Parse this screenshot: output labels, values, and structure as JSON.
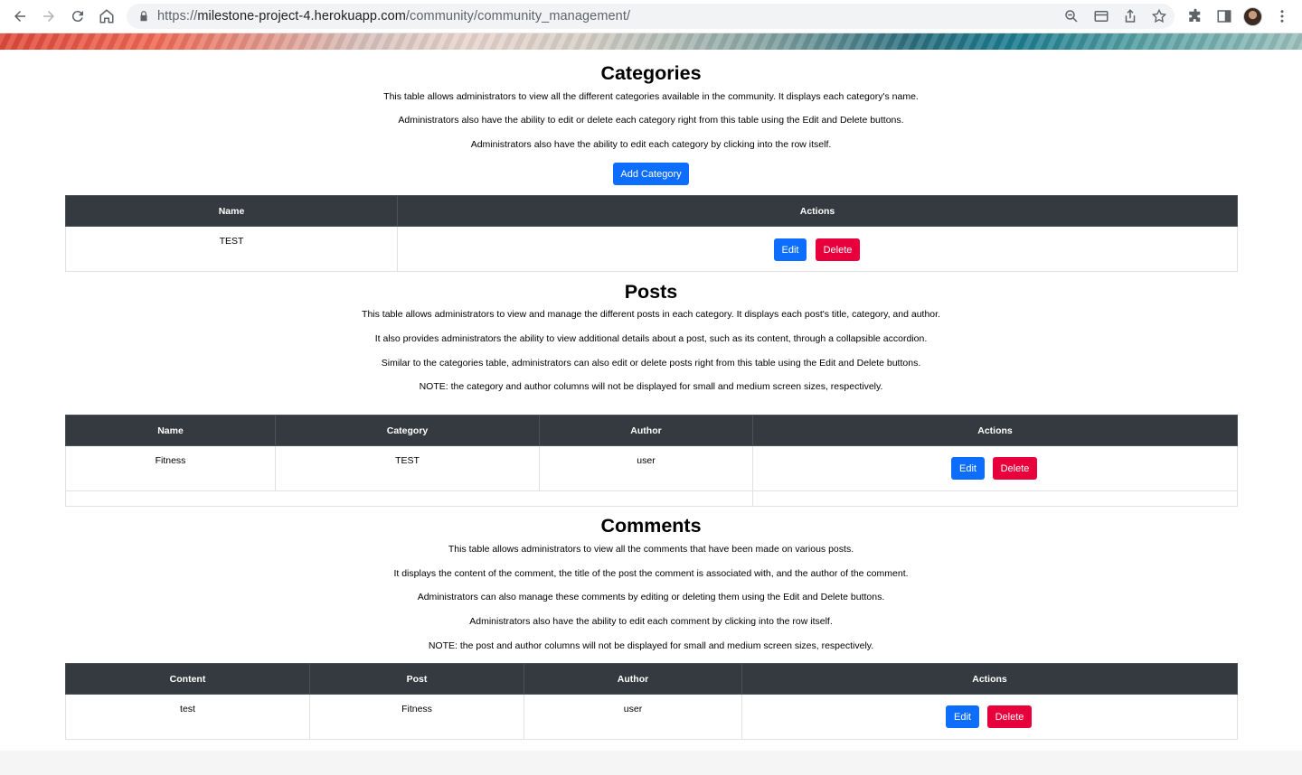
{
  "browser": {
    "url_scheme": "https://",
    "url_host": "milestone-project-4.herokuapp.com",
    "url_path": "/community/community_management/"
  },
  "categories": {
    "title": "Categories",
    "paragraphs": [
      "This table allows administrators to view all the different categories available in the community. It displays each category's name.",
      "Administrators also have the ability to edit or delete each category right from this table using the Edit and Delete buttons.",
      "Administrators also have the ability to edit each category by clicking into the row itself."
    ],
    "add_label": "Add Category",
    "headers": [
      "Name",
      "Actions"
    ],
    "rows": [
      {
        "name": "TEST"
      }
    ]
  },
  "posts": {
    "title": "Posts",
    "paragraphs": [
      "This table allows administrators to view and manage the different posts in each category. It displays each post's title, category, and author.",
      "It also provides administrators the ability to view additional details about a post, such as its content, through a collapsible accordion.",
      "Similar to the categories table, administrators can also edit or delete posts right from this table using the Edit and Delete buttons.",
      "NOTE: the category and author columns will not be displayed for small and medium screen sizes, respectively."
    ],
    "headers": [
      "Name",
      "Category",
      "Author",
      "Actions"
    ],
    "rows": [
      {
        "name": "Fitness",
        "category": "TEST",
        "author": "user"
      }
    ]
  },
  "comments": {
    "title": "Comments",
    "paragraphs": [
      "This table allows administrators to view all the comments that have been made on various posts.",
      "It displays the content of the comment, the title of the post the comment is associated with, and the author of the comment.",
      "Administrators can also manage these comments by editing or deleting them using the Edit and Delete buttons.",
      "Administrators also have the ability to edit each comment by clicking into the row itself.",
      "NOTE: the post and author columns will not be displayed for small and medium screen sizes, respectively."
    ],
    "headers": [
      "Content",
      "Post",
      "Author",
      "Actions"
    ],
    "rows": [
      {
        "content": "test",
        "post": "Fitness",
        "author": "user"
      }
    ]
  },
  "actions": {
    "edit_label": "Edit",
    "delete_label": "Delete"
  },
  "colors": {
    "primary": "#0d6efd",
    "danger": "#e8003d",
    "table_header": "#343a40"
  },
  "icons": [
    "back-arrow-icon",
    "forward-arrow-icon",
    "reload-icon",
    "home-icon",
    "lock-icon",
    "zoom-icon",
    "card-icon",
    "share-icon",
    "star-icon",
    "extensions-icon",
    "sidepanel-icon",
    "menu-dots-icon"
  ]
}
